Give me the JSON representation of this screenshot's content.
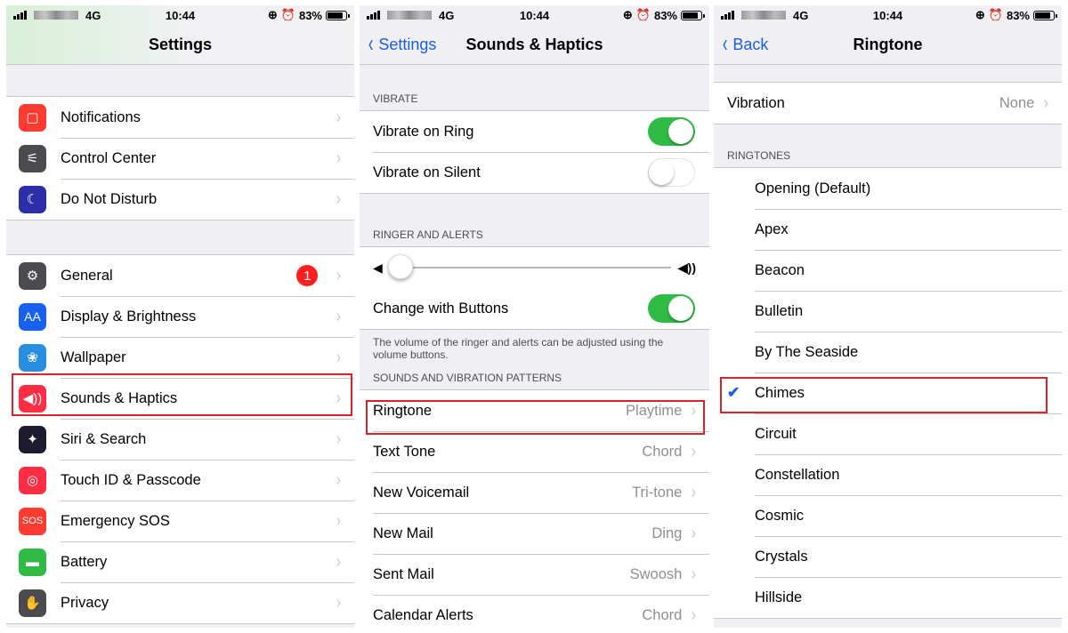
{
  "status_bar": {
    "carrier_type": "4G",
    "time": "10:44",
    "battery_percent": "83%",
    "battery_level": 0.83,
    "icons": [
      "signal-icon",
      "rotation-lock-icon",
      "alarm-icon",
      "battery-icon"
    ]
  },
  "colors": {
    "accent": "#1a5fe0",
    "toggle_on": "#2fbb45",
    "badge": "#ff1f1f",
    "highlight_box": "#d9232a"
  },
  "settings_panel": {
    "title": "Settings",
    "groups": [
      {
        "items": [
          {
            "label": "Notifications",
            "icon": "notifications-icon",
            "color": "#ff3a30"
          },
          {
            "label": "Control Center",
            "icon": "control-center-icon",
            "color": "#4a4a4f"
          },
          {
            "label": "Do Not Disturb",
            "icon": "moon-icon",
            "color": "#2c2fa8"
          }
        ]
      },
      {
        "items": [
          {
            "label": "General",
            "icon": "gear-icon",
            "color": "#4a4a4f",
            "badge": "1"
          },
          {
            "label": "Display & Brightness",
            "icon": "display-icon",
            "color": "#1861f0",
            "icon_text": "AA"
          },
          {
            "label": "Wallpaper",
            "icon": "wallpaper-icon",
            "color": "#2a8ee0"
          },
          {
            "label": "Sounds & Haptics",
            "icon": "speaker-icon",
            "color": "#ff2d44",
            "highlighted": true
          },
          {
            "label": "Siri & Search",
            "icon": "siri-icon",
            "color": "#1c1c2e"
          },
          {
            "label": "Touch ID & Passcode",
            "icon": "fingerprint-icon",
            "color": "#ff2d44"
          },
          {
            "label": "Emergency SOS",
            "icon": "sos-icon",
            "color": "#ff3a30",
            "icon_text": "SOS"
          },
          {
            "label": "Battery",
            "icon": "battery-app-icon",
            "color": "#2fbb45"
          },
          {
            "label": "Privacy",
            "icon": "hand-icon",
            "color": "#4a4a4f"
          }
        ]
      }
    ]
  },
  "sounds_panel": {
    "back_label": "Settings",
    "title": "Sounds & Haptics",
    "vibrate_header": "VIBRATE",
    "vibrate_on_ring": {
      "label": "Vibrate on Ring",
      "on": true
    },
    "vibrate_on_silent": {
      "label": "Vibrate on Silent",
      "on": false
    },
    "ringer_header": "RINGER AND ALERTS",
    "ringer_volume": 0.0,
    "change_with_buttons": {
      "label": "Change with Buttons",
      "on": true
    },
    "ringer_footnote": "The volume of the ringer and alerts can be adjusted using the volume buttons.",
    "patterns_header": "SOUNDS AND VIBRATION PATTERNS",
    "patterns": [
      {
        "label": "Ringtone",
        "value": "Playtime",
        "highlighted": true
      },
      {
        "label": "Text Tone",
        "value": "Chord"
      },
      {
        "label": "New Voicemail",
        "value": "Tri-tone"
      },
      {
        "label": "New Mail",
        "value": "Ding"
      },
      {
        "label": "Sent Mail",
        "value": "Swoosh"
      },
      {
        "label": "Calendar Alerts",
        "value": "Chord"
      }
    ]
  },
  "ringtone_panel": {
    "back_label": "Back",
    "title": "Ringtone",
    "vibration": {
      "label": "Vibration",
      "value": "None"
    },
    "ringtones_header": "RINGTONES",
    "ringtones": [
      {
        "label": "Opening (Default)"
      },
      {
        "label": "Apex"
      },
      {
        "label": "Beacon"
      },
      {
        "label": "Bulletin"
      },
      {
        "label": "By The Seaside"
      },
      {
        "label": "Chimes",
        "selected": true,
        "highlighted": true
      },
      {
        "label": "Circuit"
      },
      {
        "label": "Constellation"
      },
      {
        "label": "Cosmic"
      },
      {
        "label": "Crystals"
      },
      {
        "label": "Hillside"
      }
    ]
  },
  "glyphs": {
    "chevron": "›",
    "back_chevron": "‹",
    "checkmark": "✔"
  }
}
